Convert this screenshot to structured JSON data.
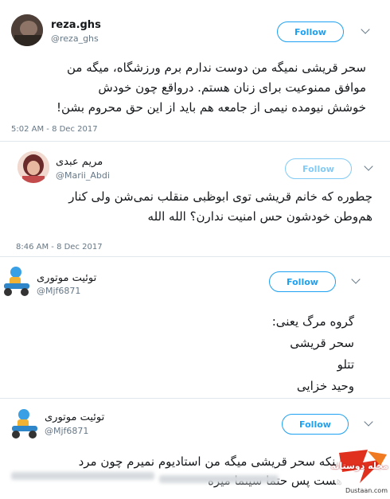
{
  "tweets": [
    {
      "name": "reza.ghs",
      "handle": "@reza_ghs",
      "follow_label": "Follow",
      "body_lines": [
        "سحر قریشی نمیگه من دوست ندارم برم ورزشگاه، میگه من",
        "موافق ممنوعیت برای زنان هستم. درواقع چون خودش",
        "خوشش نیومده نیمی از جامعه هم باید از این حق محروم بشن!"
      ],
      "timestamp": "5:02 AM - 8 Dec 2017"
    },
    {
      "name": "مریم عبدی",
      "handle": "@Marii_Abdi",
      "follow_label": "Follow",
      "body_lines": [
        "چطوره که خانم قریشی توی ابوظبی منقلب نمی‌شن ولی کنار",
        "هم‌وطن خودشون حس امنیت ندارن؟ الله الله"
      ],
      "timestamp": "8:46 AM - 8 Dec 2017"
    },
    {
      "name": "توئیت موتوری",
      "handle": "@Mjf6871",
      "follow_label": "Follow",
      "body_lines": [
        "گروه مرگ یعنی:",
        "سحر قریشی",
        "تتلو",
        "وحید خزایی"
      ]
    },
    {
      "name": "توئیت موتوری",
      "handle": "@Mjf6871",
      "follow_label": "Follow",
      "body_lines": [
        "اینکه سحر قریشی میگه من استادیوم نمیرم چون مرد",
        "هست پس حتما سینما میره"
      ]
    }
  ],
  "watermark": {
    "text": "مجله دوستانه",
    "url": "Dustaan.com"
  },
  "colors": {
    "accent": "#1da1f2",
    "text": "#14171a",
    "muted": "#657786",
    "divider": "#e1e8ed",
    "watermark_red": "#e0301e"
  },
  "icons": [
    "chevron-down-icon",
    "avatar-photo",
    "scooter-avatar"
  ]
}
